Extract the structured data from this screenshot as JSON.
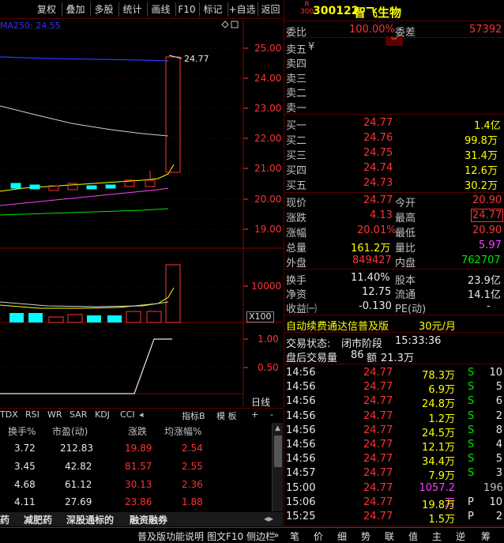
{
  "toolbar": {
    "buttons": [
      "复权",
      "叠加",
      "多股",
      "统计",
      "画线",
      "F10",
      "标记",
      "+自选",
      "返回"
    ]
  },
  "chart": {
    "ma_label": "MA250: 24.55",
    "price_ticks": [
      "25.00",
      "24.00",
      "23.00",
      "22.00",
      "21.00",
      "20.00",
      "19.00"
    ],
    "last_price_label": "24.77",
    "volume_tick": "10000",
    "volume_unit": "X100",
    "ind_ticks": [
      "1.00",
      "0.50"
    ],
    "period_label": "日线"
  },
  "indicator_tabs": [
    "TDX",
    "RSI",
    "WR",
    "SAR",
    "KDJ",
    "CCI",
    "指标B",
    "模 板",
    "+",
    "-"
  ],
  "watchlist": {
    "headers": [
      "换手%",
      "市盈(动)",
      "涨跌",
      "均涨幅%"
    ],
    "rows": [
      [
        "3.72",
        "212.83",
        "19.89",
        "2.54"
      ],
      [
        "3.45",
        "42.82",
        "81.57",
        "2.55"
      ],
      [
        "4.68",
        "61.12",
        "30.13",
        "2.36"
      ],
      [
        "4.11",
        "27.69",
        "23.86",
        "1.88"
      ]
    ]
  },
  "bottom_tabs": [
    "药",
    "减肥药",
    "深股通标的",
    "融资融券"
  ],
  "status_bar": {
    "help": "普及版功能说明",
    "f10": "图文F10",
    "scroll": "侧边栏",
    "arrow": "»"
  },
  "quote": {
    "badge_top": "R",
    "badge_bottom": "300",
    "code": "300122",
    "name": "智飞生物",
    "wei_bi_label": "委比",
    "wei_bi": "100.00%",
    "wei_cha_label": "委差",
    "wei_cha": "57392",
    "yen": "¥",
    "sell_labels": [
      "卖五",
      "卖四",
      "卖三",
      "卖二",
      "卖一"
    ],
    "buy": [
      {
        "label": "买一",
        "price": "24.77",
        "vol": "1.4亿"
      },
      {
        "label": "买二",
        "price": "24.76",
        "vol": "99.8万"
      },
      {
        "label": "买三",
        "price": "24.75",
        "vol": "31.4万"
      },
      {
        "label": "买四",
        "price": "24.74",
        "vol": "12.6万"
      },
      {
        "label": "买五",
        "price": "24.73",
        "vol": "30.2万"
      }
    ],
    "stats": [
      {
        "l1": "现价",
        "v1": "24.77",
        "l2": "今开",
        "v2": "20.90"
      },
      {
        "l1": "涨跌",
        "v1": "4.13",
        "l2": "最高",
        "v2": "24.77"
      },
      {
        "l1": "涨幅",
        "v1": "20.01%",
        "l2": "最低",
        "v2": "20.90"
      },
      {
        "l1": "总量",
        "v1": "161.2万",
        "l2": "量比",
        "v2": "5.97"
      },
      {
        "l1": "外盘",
        "v1": "849427",
        "l2": "内盘",
        "v2": "762707"
      }
    ],
    "fin": [
      {
        "l1": "换手",
        "v1": "11.40%",
        "l2": "股本",
        "v2": "23.9亿"
      },
      {
        "l1": "净资",
        "v1": "12.75",
        "l2": "流通",
        "v2": "14.1亿"
      },
      {
        "l1": "收益㈠",
        "v1": "-0.130",
        "l2": "PE(动)",
        "v2": "-"
      }
    ],
    "promo": "自动续费通达信普及版",
    "promo_price": "30元/月",
    "trade_status_label": "交易状态:",
    "trade_status": "闭市阶段",
    "trade_time": "15:33:36",
    "after_label": "盘后交易量",
    "after_vol": "86",
    "after_amt_label": "额",
    "after_amt": "21.3万"
  },
  "ticks": [
    {
      "t": "14:56",
      "p": "24.77",
      "v": "78.3万",
      "d": "S",
      "n": "10"
    },
    {
      "t": "14:56",
      "p": "24.77",
      "v": "6.9万",
      "d": "S",
      "n": "5"
    },
    {
      "t": "14:56",
      "p": "24.77",
      "v": "24.8万",
      "d": "S",
      "n": "6"
    },
    {
      "t": "14:56",
      "p": "24.77",
      "v": "1.2万",
      "d": "S",
      "n": "2"
    },
    {
      "t": "14:56",
      "p": "24.77",
      "v": "24.5万",
      "d": "S",
      "n": "8"
    },
    {
      "t": "14:56",
      "p": "24.77",
      "v": "12.1万",
      "d": "S",
      "n": "4"
    },
    {
      "t": "14:56",
      "p": "24.77",
      "v": "34.4万",
      "d": "S",
      "n": "5"
    },
    {
      "t": "14:57",
      "p": "24.77",
      "v": "7.9万",
      "d": "S",
      "n": "3"
    },
    {
      "t": "15:00",
      "p": "24.77",
      "v": "1057.2万",
      "d": "",
      "n": "196"
    },
    {
      "t": "15:06",
      "p": "24.77",
      "v": "19.8万",
      "d": "P",
      "n": "10"
    },
    {
      "t": "15:25",
      "p": "24.77",
      "v": "1.5万",
      "d": "P",
      "n": "2"
    }
  ],
  "right_tabs": [
    "笔",
    "价",
    "细",
    "势",
    "联",
    "值",
    "主",
    "逆",
    "筹"
  ]
}
